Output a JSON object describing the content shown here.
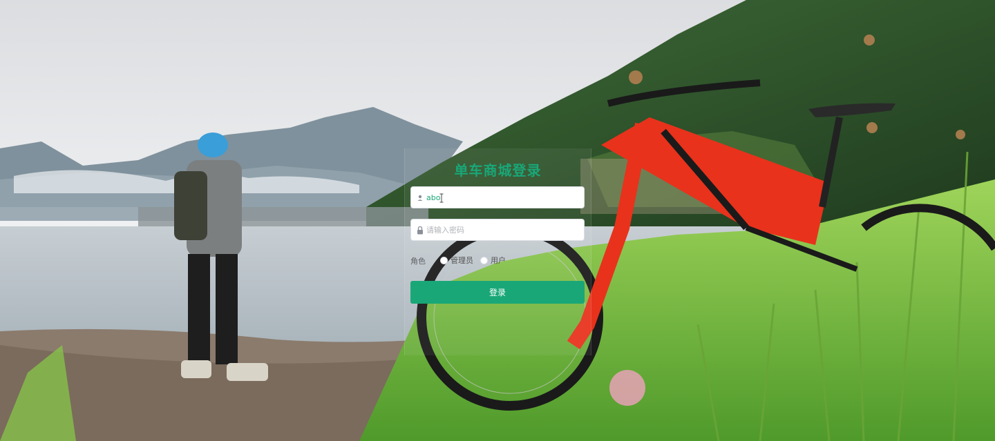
{
  "login": {
    "title": "单车商城登录",
    "username_value": "abo",
    "password_placeholder": "请输入密码",
    "role_label": "角色",
    "role_options": [
      "管理员",
      "用户"
    ],
    "submit_label": "登录"
  },
  "colors": {
    "accent": "#19a778",
    "bike_frame": "#e8321c"
  },
  "icons": {
    "username": "user-icon",
    "password": "lock-icon"
  }
}
